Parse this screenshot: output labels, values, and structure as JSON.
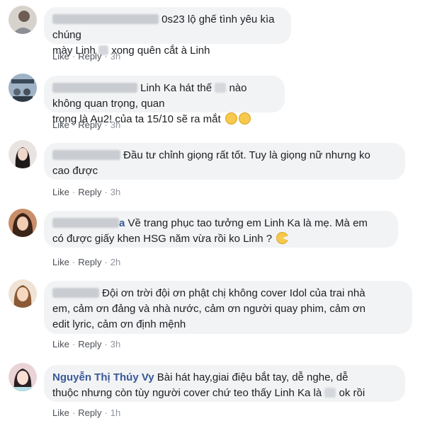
{
  "comments": [
    {
      "author": "",
      "text_line1": "0s23 lộ ghế tình yêu kìa chúng",
      "text_line2_a": "mày Linh",
      "text_line2_b": "xong quên cắt à Linh",
      "like": "Like",
      "reply": "Reply",
      "time": "3h"
    },
    {
      "author": "",
      "text_line1": "Linh Ka hát thế",
      "text_line1_b": "nào không quan trọng, quan",
      "text_line2": "trọng là Au2! của ta 15/10 sẽ ra mắt",
      "like": "Like",
      "reply": "Reply",
      "time": "3h"
    },
    {
      "author": "",
      "text_line1": "Đầu tư chỉnh giọng rất tốt. Tuy là giọng nữ nhưng ko",
      "text_line2": "cao được",
      "like": "Like",
      "reply": "Reply",
      "time": "3h"
    },
    {
      "author": "a",
      "text_line1": "Về trang phục tao tưởng em Linh Ka là mẹ. Mà em",
      "text_line2": "có được giấy khen HSG năm vừa rồi ko Linh ?",
      "like": "Like",
      "reply": "Reply",
      "time": "2h"
    },
    {
      "author": "",
      "text_line1": "Đội ơn trời đội ơn phật chị không cover Idol của trai nhà",
      "text_line2": "em, cảm ơn đảng và nhà nước, cảm ơn người quay phim, cảm ơn",
      "text_line3": "edit lyric, cảm ơn định mệnh",
      "like": "Like",
      "reply": "Reply",
      "time": "3h"
    },
    {
      "author": "Nguyễn Thị Thúy Vy",
      "text_line1": "Bài hát hay,giai điệu bắt tay, dễ nghe, dễ",
      "text_line2_a": "thuộc nhưng còn tùy người cover chứ teo thấy Linh Ka là",
      "text_line2_b": "ok rồi",
      "like": "Like",
      "reply": "Reply",
      "time": "1h"
    }
  ],
  "colors": {
    "bubble": "#f2f3f5",
    "author": "#385898",
    "text": "#1c1e21",
    "meta": "#90949c",
    "emoji": "#f6c94c"
  }
}
